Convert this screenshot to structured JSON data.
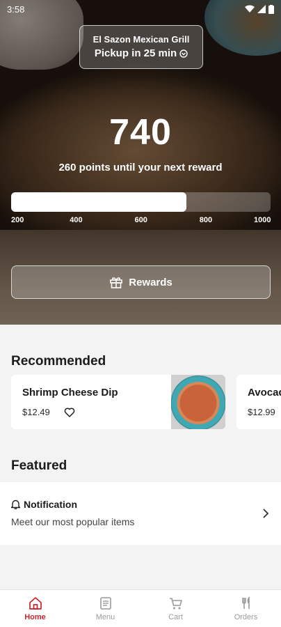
{
  "status_bar": {
    "time": "3:58"
  },
  "hero": {
    "store_name": "El Sazon Mexican Grill",
    "pickup_text": "Pickup in 25 min",
    "points": "740",
    "points_subtitle": "260 points until your next reward",
    "progress": {
      "min": 200,
      "max": 1000,
      "current": 740
    },
    "ticks": [
      "200",
      "400",
      "600",
      "800",
      "1000"
    ],
    "rewards_label": "Rewards"
  },
  "recommended": {
    "title": "Recommended",
    "items": [
      {
        "name": "Shrimp Cheese Dip",
        "price": "$12.49"
      },
      {
        "name": "Avocado",
        "price": "$12.99"
      }
    ]
  },
  "featured": {
    "title": "Featured",
    "item": {
      "title": "Notification",
      "subtitle": "Meet our most popular items"
    }
  },
  "nav": {
    "items": [
      {
        "label": "Home",
        "icon": "home-icon"
      },
      {
        "label": "Menu",
        "icon": "menu-icon"
      },
      {
        "label": "Cart",
        "icon": "cart-icon"
      },
      {
        "label": "Orders",
        "icon": "orders-icon"
      }
    ],
    "active": "Home"
  },
  "colors": {
    "accent": "#c8242b",
    "background": "#f3f3f3",
    "card": "#ffffff"
  }
}
